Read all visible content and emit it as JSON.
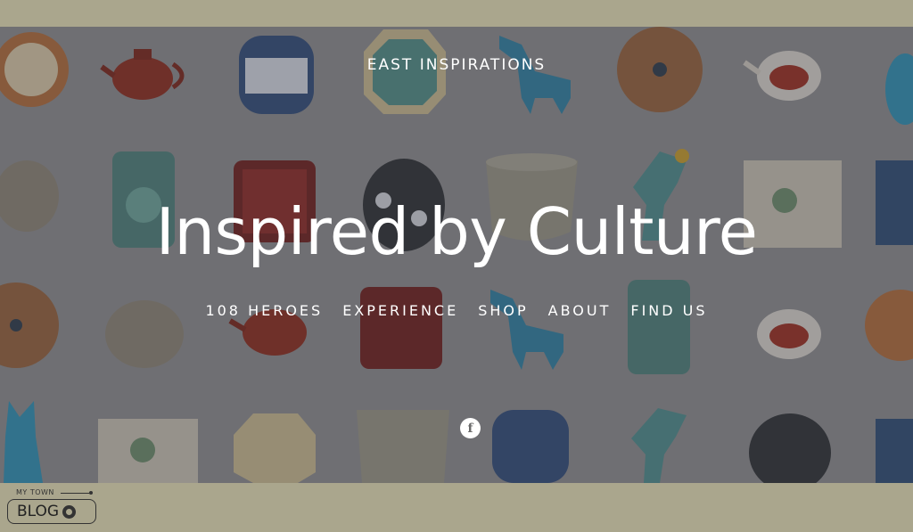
{
  "site": {
    "title": "EAST INSPIRATIONS",
    "headline": "Inspired by Culture"
  },
  "nav": [
    {
      "label": "108 HEROES"
    },
    {
      "label": "EXPERIENCE"
    },
    {
      "label": "SHOP"
    },
    {
      "label": "ABOUT"
    },
    {
      "label": "FIND US"
    }
  ],
  "social": {
    "facebook_glyph": "f"
  },
  "badge": {
    "small_text": "MY TOWN",
    "big_text": "BLOG"
  },
  "colors": {
    "frame": "#aaa68d",
    "overlay": "#8b8b8e",
    "text": "#ffffff"
  }
}
